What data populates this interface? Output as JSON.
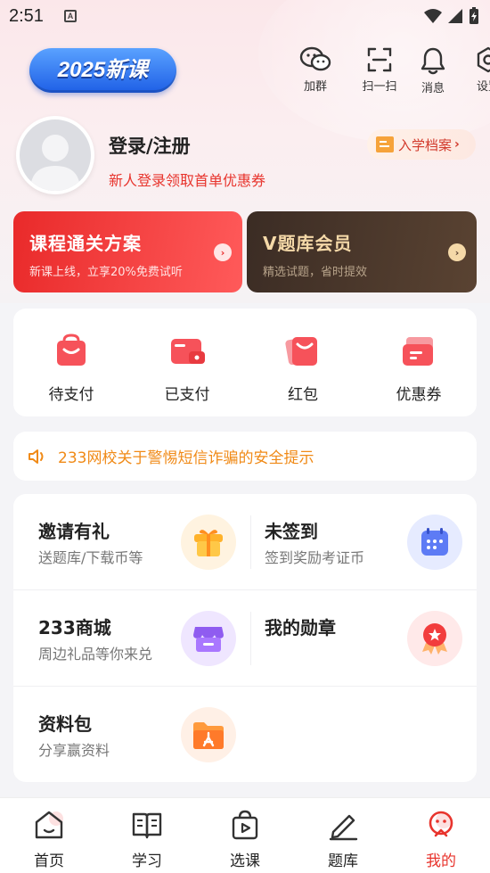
{
  "status_bar": {
    "time": "2:51",
    "notif_letter": "A"
  },
  "header": {
    "badge": "2025新课",
    "tools": [
      {
        "icon": "wechat-group-icon",
        "label": "加群"
      },
      {
        "icon": "scan-icon",
        "label": "扫一扫"
      },
      {
        "icon": "bell-icon",
        "label": "消息"
      },
      {
        "icon": "settings-icon",
        "label": "设置"
      }
    ]
  },
  "profile": {
    "login_label": "登录/注册",
    "promo_text": "新人登录领取首单优惠券",
    "archive_label": "入学档案"
  },
  "promos": [
    {
      "title": "课程通关方案",
      "subtitle": "新课上线，立享20%免费试听"
    },
    {
      "title": "V题库会员",
      "subtitle": "精选试题，省时提效"
    }
  ],
  "orders": [
    {
      "icon": "pending-payment-icon",
      "label": "待支付"
    },
    {
      "icon": "paid-icon",
      "label": "已支付"
    },
    {
      "icon": "red-packet-icon",
      "label": "红包"
    },
    {
      "icon": "coupon-icon",
      "label": "优惠券"
    }
  ],
  "notice": {
    "text": "233网校关于警惕短信诈骗的安全提示"
  },
  "features": [
    {
      "title": "邀请有礼",
      "subtitle": "送题库/下载币等",
      "icon": "gift-icon"
    },
    {
      "title": "未签到",
      "subtitle": "签到奖励考证币",
      "icon": "calendar-icon"
    },
    {
      "title": "233商城",
      "subtitle": "周边礼品等你来兑",
      "icon": "shop-icon"
    },
    {
      "title": "我的勋章",
      "subtitle": "",
      "icon": "medal-icon"
    },
    {
      "title": "资料包",
      "subtitle": "分享赢资料",
      "icon": "folder-pdf-icon"
    }
  ],
  "tabs": [
    {
      "icon": "home-icon",
      "label": "首页",
      "active": false
    },
    {
      "icon": "book-icon",
      "label": "学习",
      "active": false
    },
    {
      "icon": "course-bag-icon",
      "label": "选课",
      "active": false
    },
    {
      "icon": "pencil-icon",
      "label": "题库",
      "active": false
    },
    {
      "icon": "my-icon",
      "label": "我的",
      "active": true
    }
  ],
  "colors": {
    "accent": "#e8342d",
    "notice": "#f08a17",
    "brand_blue": "#1e5fe6"
  }
}
